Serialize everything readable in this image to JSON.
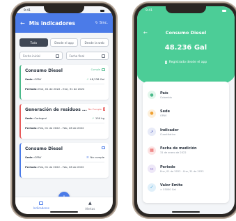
{
  "left": {
    "status_time": "9:41",
    "appbar": {
      "title": "Mis indicadores",
      "sync_label": "Sinc."
    },
    "tabs": [
      {
        "label": "Todo",
        "active": true
      },
      {
        "label": "Desde el app",
        "active": false
      },
      {
        "label": "Desde la web",
        "active": false
      }
    ],
    "dates": {
      "start_placeholder": "Fecha inicial",
      "end_placeholder": "Fecha final"
    },
    "cards": [
      {
        "title": "Consumo Diesel",
        "badge": "Cumple",
        "badge_color": "#4ab98a",
        "sede_label": "Sede:",
        "sede": "OPAV",
        "value": "48,236 Gal",
        "periodo_label": "Periodo:",
        "periodo": "Ene, 01 de 2022 - Ene, 31 de 2022",
        "style": "green"
      },
      {
        "title": "Generación de residuos ...",
        "badge": "No Cumple",
        "badge_color": "#e85a5a",
        "sede_label": "Sede:",
        "sede": "Cartagral",
        "value": "150 kg",
        "periodo_label": "Periodo:",
        "periodo": "Feb, 01 de 2022 - Feb, 28 de 2022",
        "style": "red"
      },
      {
        "title": "Consumo Diesel",
        "badge": "",
        "badge_color": "#4b7be8",
        "sede_label": "Sede:",
        "sede": "OPAV",
        "value": "No cumple",
        "periodo_label": "Periodo:",
        "periodo": "Feb, 01 de 2022 - Feb, 28 de 2022",
        "style": "blue"
      }
    ],
    "bottom_nav": {
      "indicadores": "Indicadores",
      "alertas": "Alertas",
      "fab_label": "+"
    }
  },
  "right": {
    "status_time": "9:41",
    "header": {
      "title": "Consumo Diesel",
      "value": "48.236 Gal",
      "subtitle": "Registrado desde el app"
    },
    "details": [
      {
        "label": "País",
        "value": "Colombia",
        "icon": "globe-icon",
        "color": "#4ab98a",
        "bg": "#e3f6ec"
      },
      {
        "label": "Sede",
        "value": "OPAV",
        "icon": "pin-icon",
        "color": "#f0a030",
        "bg": "#fdf0dc"
      },
      {
        "label": "Indicador",
        "value": "Cuantitativo",
        "icon": "trend-icon",
        "color": "#6070c8",
        "bg": "#e8ebf8"
      },
      {
        "label": "Fecha de medición",
        "value": "31 de enero de 2022",
        "icon": "calendar-icon",
        "color": "#e85a5a",
        "bg": "#fce4e4"
      },
      {
        "label": "Periodo",
        "value": "Ene, 01 de 2022 - Ene, 31 de 2022",
        "icon": "range-icon",
        "color": "#8a70c8",
        "bg": "#eee8f8"
      },
      {
        "label": "Valor Emite",
        "value": "> 55000 Gal",
        "icon": "check-icon",
        "color": "#3a9ed8",
        "bg": "#e0f0fa"
      }
    ]
  }
}
